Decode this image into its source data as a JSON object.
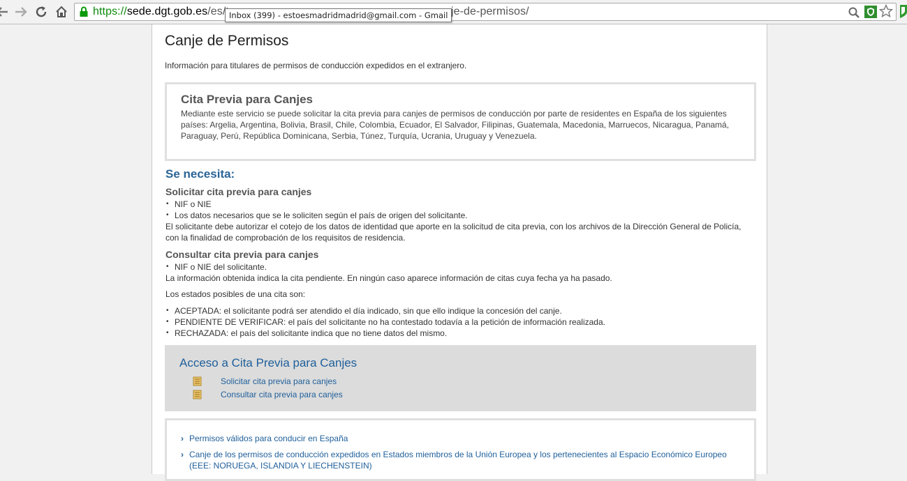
{
  "browser": {
    "url_scheme": "https://",
    "url_host": "sede.dgt.gob.es",
    "url_path_start": "/es/t",
    "url_path_end": "anje-de-permisos/",
    "tooltip": "Inbox (399) - estoesmadridmadrid@gmail.com - Gmail",
    "icons": [
      "back-icon",
      "forward-icon",
      "reload-icon",
      "home-icon",
      "lock-icon",
      "search-icon",
      "extension-shield-icon",
      "star-icon"
    ]
  },
  "page": {
    "title": "Canje de Permisos",
    "intro": "Información para titulares de permisos de conducción expedidos en el extranjero."
  },
  "cita_box": {
    "title": "Cita Previa para Canjes",
    "text": "Mediante este servicio se puede solicitar la cita previa para canjes de permisos de conducción por parte de residentes en España de los siguientes países: Argelia, Argentina, Bolivia, Brasil, Chile, Colombia, Ecuador, El Salvador, Filipinas, Guatemala, Macedonia, Marruecos, Nicaragua, Panamá, Paraguay, Perú, República Dominicana, Serbia, Túnez, Turquía, Ucrania, Uruguay y Venezuela."
  },
  "necesita": {
    "heading": "Se necesita:",
    "solicitar": {
      "heading": "Solicitar cita previa para canjes",
      "items": [
        "NIF o NIE",
        "Los datos necesarios que se le soliciten según el país de origen del solicitante."
      ],
      "note": "El solicitante debe autorizar el cotejo de los datos de identidad que aporte en la solicitud de cita previa, con los archivos de la Dirección General de Policía, con la finalidad de comprobación de los requisitos de residencia."
    },
    "consultar": {
      "heading": "Consultar cita previa para canjes",
      "items": [
        "NIF o NIE del solicitante."
      ],
      "note": "La información obtenida indica la cita pendiente. En ningún caso aparece información de citas cuya fecha ya ha pasado.",
      "estados_intro": "Los estados posibles de una cita son:",
      "estados": [
        "ACEPTADA: el solicitante podrá ser atendido el día indicado, sin que ello indique la concesión del canje.",
        "PENDIENTE DE VERIFICAR: el país del solicitante no ha contestado todavía a la petición de información realizada.",
        "RECHAZADA: el país del solicitante indica que no tiene datos del mismo."
      ]
    }
  },
  "acceso": {
    "title": "Acceso a Cita Previa para Canjes",
    "links": [
      "Solicitar cita previa para canjes",
      "Consultar cita previa para canjes"
    ]
  },
  "related": {
    "links": [
      "Permisos válidos para conducir en España",
      "Canje de los permisos de conducción expedidos en Estados miembros de la Unión Europea y los pertenecientes al Espacio Económico Europeo (EEE: NORUEGA, ISLANDIA Y LIECHENSTEIN)"
    ]
  },
  "colors": {
    "link": "#1f5f9a",
    "heading_blue": "#2a6496",
    "box_border": "#e0e0e0",
    "access_bg": "#dcdcdc"
  }
}
